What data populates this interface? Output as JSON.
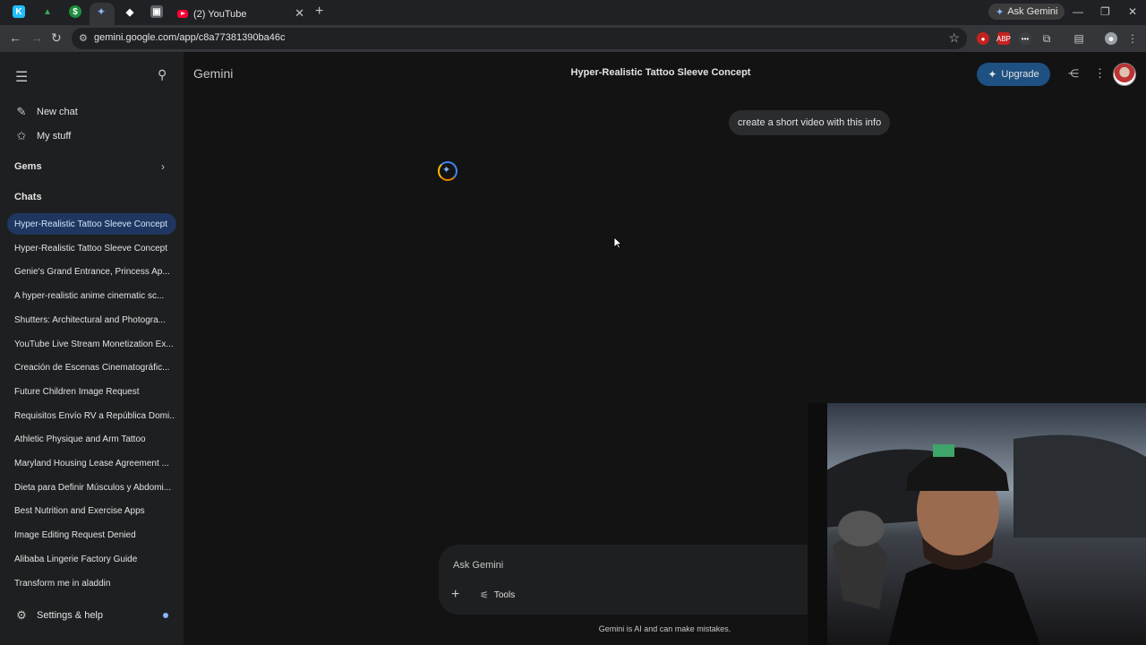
{
  "browser": {
    "tabs": [
      {
        "icon": "kaggle-k-icon",
        "color": "#20BEFF"
      },
      {
        "icon": "google-drive-icon",
        "color": "#34a853"
      },
      {
        "icon": "green-dollar-icon",
        "color": "#1e8e3e"
      },
      {
        "icon": "gemini-spark-icon",
        "active": true
      },
      {
        "icon": "diamond-icon"
      },
      {
        "icon": "app-square-icon"
      },
      {
        "icon": "youtube-icon",
        "title": "(2) YouTube"
      }
    ],
    "ask_gemini_label": "Ask Gemini",
    "url": "gemini.google.com/app/c8a77381390ba46c"
  },
  "app": {
    "brand": "Gemini",
    "conversation_title": "Hyper-Realistic Tattoo Sleeve Concept",
    "upgrade_label": "Upgrade",
    "accent": "#1e5081"
  },
  "sidebar": {
    "new_chat": "New chat",
    "my_stuff": "My stuff",
    "gems_heading": "Gems",
    "chats_heading": "Chats",
    "chats": [
      "Hyper-Realistic Tattoo Sleeve Concept",
      "Hyper-Realistic Tattoo Sleeve Concept",
      "Genie's Grand Entrance, Princess Ap...",
      "A hyper-realistic anime cinematic sc...",
      "Shutters: Architectural and Photogra...",
      "YouTube Live Stream Monetization Ex...",
      "Creación de Escenas Cinematográfic...",
      "Future Children Image Request",
      "Requisitos Envío RV a República Domi...",
      "Athletic Physique and Arm Tattoo",
      "Maryland Housing Lease Agreement ...",
      "Dieta para Definir Músculos y Abdomi...",
      "Best Nutrition and Exercise Apps",
      "Image Editing Request Denied",
      "Alibaba Lingerie Factory Guide",
      "Transform me in aladdin"
    ],
    "active_chat_index": 0,
    "settings": "Settings & help"
  },
  "conversation": {
    "user_message": "create a short video with this info"
  },
  "composer": {
    "placeholder": "Ask Gemini",
    "tools_label": "Tools"
  },
  "disclaimer": "Gemini is AI and can make mistakes."
}
